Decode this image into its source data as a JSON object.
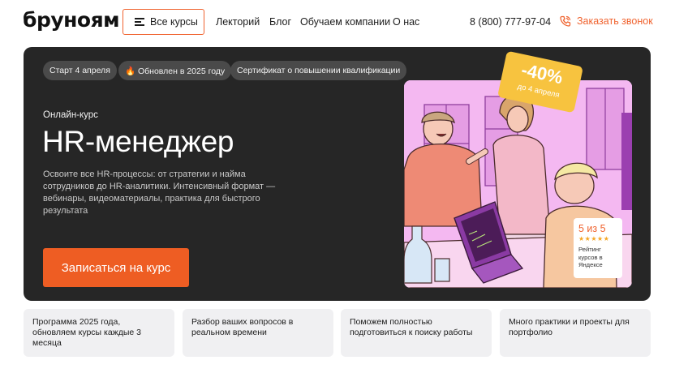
{
  "header": {
    "logo": "бруноям",
    "courses_button": "Все курсы",
    "nav": [
      "Лекторий",
      "Блог",
      "Обучаем компании",
      "О нас"
    ],
    "phone": "8 (800) 777-97-04",
    "callback": "Заказать звонок"
  },
  "hero": {
    "chips": [
      "Старт 4 апреля",
      "🔥 Обновлен в 2025 году",
      "Сертификат о повышении квалификации"
    ],
    "eyebrow": "Онлайн-курс",
    "title": "HR-менеджер",
    "description": "Освоите все HR-процессы: от стратегии и найма сотрудников до HR-аналитики. Интенсивный формат — вебинары, видеоматериалы, практика для быстрого результата",
    "cta": "Записаться на курс",
    "discount": {
      "percent": "-40%",
      "until": "до 4 апреля"
    },
    "rating": {
      "score": "5 из 5",
      "stars": "★★★★★",
      "label": "Рейтинг курсов в Яндексе"
    }
  },
  "features": [
    "Программа 2025 года, обновляем курсы каждые 3 месяца",
    "Разбор ваших вопросов в реальном времени",
    "Поможем полностью подготовиться к поиску работы",
    "Много практики и проекты для портфолио"
  ],
  "colors": {
    "accent": "#ee5d23",
    "hero_bg": "#262626",
    "card_bg": "#f0f0f2",
    "badge": "#f7c33f"
  }
}
